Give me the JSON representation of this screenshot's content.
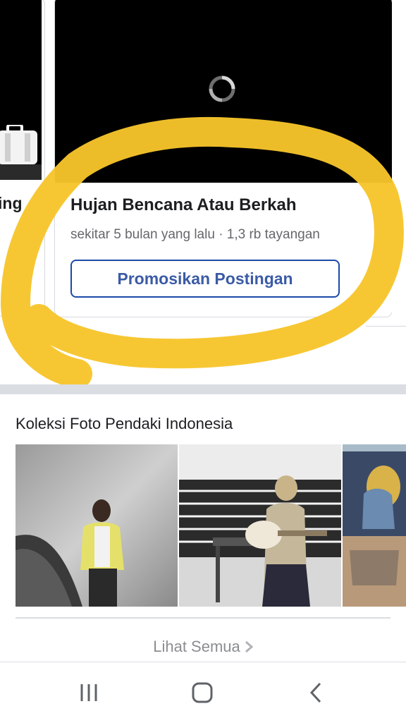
{
  "left_card": {
    "title": "ing"
  },
  "main_card": {
    "title": "Hujan Bencana Atau Berkah",
    "meta": "sekitar 5 bulan yang lalu · 1,3 rb tayangan",
    "promote_label": "Promosikan Postingan"
  },
  "collection": {
    "title": "Koleksi Foto Pendaki Indonesia",
    "see_all_label": "Lihat Semua"
  },
  "colors": {
    "primary_blue": "#3b5ba5",
    "highlight_yellow": "#f7c52b",
    "text_dark": "#1c1e21",
    "text_muted": "#65676b"
  }
}
